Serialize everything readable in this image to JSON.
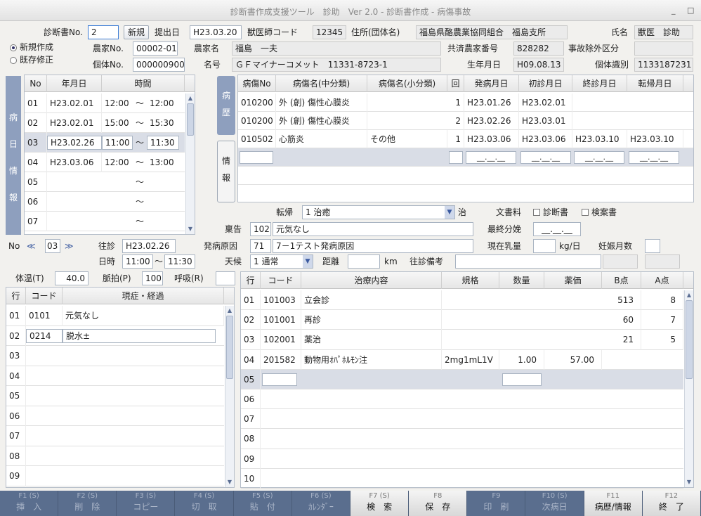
{
  "window": {
    "title": "診断書作成支援ツール　診助　Ver 2.0 - 診断書作成 - 病傷事故",
    "min_icon": "_",
    "close_icon": "□"
  },
  "header": {
    "cert_no_label": "診断書No.",
    "cert_no": "2",
    "new_button": "新規",
    "submit_label": "提出日",
    "submit_date": "H23.03.20",
    "vet_code_label": "獣医師コード",
    "vet_code": "12345",
    "address_label": "住所(団体名)",
    "address": "福島県酪農業協同組合　福島支所",
    "name_label": "氏名",
    "name": "獣医　診助",
    "mode_new": "新規作成",
    "mode_edit": "既存修正",
    "farm_no_label": "農家No.",
    "farm_no": "00002-01",
    "farm_name_label": "農家名",
    "farm_name": "福島　一夫",
    "mutual_no_label": "共済農家番号",
    "mutual_no": "828282",
    "accident_label": "事故除外区分",
    "accident_value": "",
    "indiv_no_label": "個体No.",
    "indiv_no": "0000009000",
    "animal_name_label": "名号",
    "animal_name": "ＧＦマイナーコメット　11331-8723-1",
    "birth_label": "生年月日",
    "birth": "H09.08.13",
    "indiv_id_label": "個体識別",
    "indiv_id": "1133187231"
  },
  "visit_side_label": [
    "病",
    "日",
    "情",
    "報"
  ],
  "visits": {
    "headers": [
      "No",
      "年月日",
      "時間"
    ],
    "rows": [
      {
        "no": "01",
        "date": "H23.02.01",
        "from": "12:00",
        "sep": "～",
        "to": "12:00"
      },
      {
        "no": "02",
        "date": "H23.02.01",
        "from": "15:00",
        "sep": "～",
        "to": "15:30"
      },
      {
        "no": "03",
        "date": "H23.02.26",
        "from": "11:00",
        "sep": "～",
        "to": "11:30"
      },
      {
        "no": "04",
        "date": "H23.03.06",
        "from": "12:00",
        "sep": "～",
        "to": "13:00"
      },
      {
        "no": "05",
        "date": "",
        "from": "",
        "sep": "～",
        "to": ""
      },
      {
        "no": "06",
        "date": "",
        "from": "",
        "sep": "～",
        "to": ""
      },
      {
        "no": "07",
        "date": "",
        "from": "",
        "sep": "～",
        "to": ""
      }
    ]
  },
  "history_tab": [
    "病",
    "歴"
  ],
  "info_tab": [
    "情",
    "報"
  ],
  "disease": {
    "headers": [
      "病傷No",
      "病傷名(中分類)",
      "病傷名(小分類)",
      "回",
      "発病月日",
      "初診月日",
      "終診月日",
      "転帰月日"
    ],
    "rows": [
      {
        "code": "010200",
        "mid": "外 (創) 傷性心膜炎",
        "small": "",
        "count": "1",
        "onset": "H23.01.26",
        "first": "H23.02.01",
        "last": "",
        "outcome": ""
      },
      {
        "code": "010200",
        "mid": "外 (創) 傷性心膜炎",
        "small": "",
        "count": "2",
        "onset": "H23.02.26",
        "first": "H23.03.01",
        "last": "",
        "outcome": ""
      },
      {
        "code": "010502",
        "mid": "心筋炎",
        "small": "その他",
        "count": "1",
        "onset": "H23.03.06",
        "first": "H23.03.06",
        "last": "H23.03.10",
        "outcome": "H23.03.10"
      }
    ],
    "blank_date": "__.__.__"
  },
  "outcome": {
    "label": "転帰",
    "value": "1 治癒",
    "suffix": "治",
    "doc_fee_label": "文書料",
    "doc_chk1": "診断書",
    "doc_chk2": "検案書"
  },
  "memo": {
    "label": "稟告",
    "code": "102",
    "text": "元気なし",
    "last_calving_label": "最終分娩",
    "last_calving": "__.__.__"
  },
  "cause": {
    "label": "発病原因",
    "code": "71",
    "text": "7－1テスト発病原因",
    "milk_label": "現在乳量",
    "milk_unit": "kg/日",
    "preg_label": "妊娠月数"
  },
  "nav": {
    "no_label": "No",
    "prev": "≪",
    "current": "03",
    "next": "≫",
    "visit_label": "往診",
    "visit_date": "H23.02.26",
    "time_label": "日時",
    "time_from": "11:00",
    "time_sep": "～",
    "time_to": "11:30"
  },
  "weather": {
    "label": "天候",
    "value": "1 通常",
    "dist_label": "距離",
    "dist_unit": "km",
    "note_label": "往診備考"
  },
  "vitals": {
    "temp_label": "体温(T)",
    "temp": "40.0",
    "pulse_label": "脈拍(P)",
    "pulse": "100",
    "resp_label": "呼吸(R)",
    "resp": ""
  },
  "symptoms": {
    "headers": [
      "行",
      "コード",
      "現症・経過"
    ],
    "rows": [
      {
        "no": "01",
        "code": "0101",
        "text": "元気なし"
      },
      {
        "no": "02",
        "code": "0214",
        "text": "脱水±"
      },
      {
        "no": "03",
        "code": "",
        "text": ""
      },
      {
        "no": "04",
        "code": "",
        "text": ""
      },
      {
        "no": "05",
        "code": "",
        "text": ""
      },
      {
        "no": "06",
        "code": "",
        "text": ""
      },
      {
        "no": "07",
        "code": "",
        "text": ""
      },
      {
        "no": "08",
        "code": "",
        "text": ""
      },
      {
        "no": "09",
        "code": "",
        "text": ""
      }
    ]
  },
  "treatments": {
    "headers": [
      "行",
      "コード",
      "治療内容",
      "規格",
      "数量",
      "薬価",
      "B点",
      "A点"
    ],
    "rows": [
      {
        "no": "01",
        "code": "101003",
        "name": "立会診",
        "spec": "",
        "qty": "",
        "price": "",
        "b": "513",
        "a": "8"
      },
      {
        "no": "02",
        "code": "101001",
        "name": "再診",
        "spec": "",
        "qty": "",
        "price": "",
        "b": "60",
        "a": "7"
      },
      {
        "no": "03",
        "code": "102001",
        "name": "薬治",
        "spec": "",
        "qty": "",
        "price": "",
        "b": "21",
        "a": "5"
      },
      {
        "no": "04",
        "code": "201582",
        "name": "動物用ｵﾊﾟﾎﾙﾓﾝ注",
        "spec": "2mg1mL1V",
        "qty": "1.00",
        "price": "57.00",
        "b": "",
        "a": ""
      },
      {
        "no": "05",
        "code": "",
        "name": "",
        "spec": "",
        "qty": "",
        "price": "",
        "b": "",
        "a": ""
      },
      {
        "no": "06",
        "code": "",
        "name": "",
        "spec": "",
        "qty": "",
        "price": "",
        "b": "",
        "a": ""
      },
      {
        "no": "07",
        "code": "",
        "name": "",
        "spec": "",
        "qty": "",
        "price": "",
        "b": "",
        "a": ""
      },
      {
        "no": "08",
        "code": "",
        "name": "",
        "spec": "",
        "qty": "",
        "price": "",
        "b": "",
        "a": ""
      },
      {
        "no": "09",
        "code": "",
        "name": "",
        "spec": "",
        "qty": "",
        "price": "",
        "b": "",
        "a": ""
      },
      {
        "no": "10",
        "code": "",
        "name": "",
        "spec": "",
        "qty": "",
        "price": "",
        "b": "",
        "a": ""
      }
    ]
  },
  "fkeys": [
    {
      "key": "F1 (S)",
      "label": "挿　入",
      "active": false
    },
    {
      "key": "F2 (S)",
      "label": "削　除",
      "active": false
    },
    {
      "key": "F3 (S)",
      "label": "コピー",
      "active": false
    },
    {
      "key": "F4 (S)",
      "label": "切　取",
      "active": false
    },
    {
      "key": "F5 (S)",
      "label": "貼　付",
      "active": false
    },
    {
      "key": "F6 (S)",
      "label": "ｶﾚﾝﾀﾞｰ",
      "active": false
    },
    {
      "key": "F7 (S)",
      "label": "検　索",
      "active": true
    },
    {
      "key": "F8",
      "label": "保　存",
      "active": true
    },
    {
      "key": "F9",
      "label": "印　刷",
      "active": false
    },
    {
      "key": "F10 (S)",
      "label": "次病日",
      "active": false
    },
    {
      "key": "F11",
      "label": "病歴/情報",
      "active": true
    },
    {
      "key": "F12",
      "label": "終　了",
      "active": true
    }
  ]
}
